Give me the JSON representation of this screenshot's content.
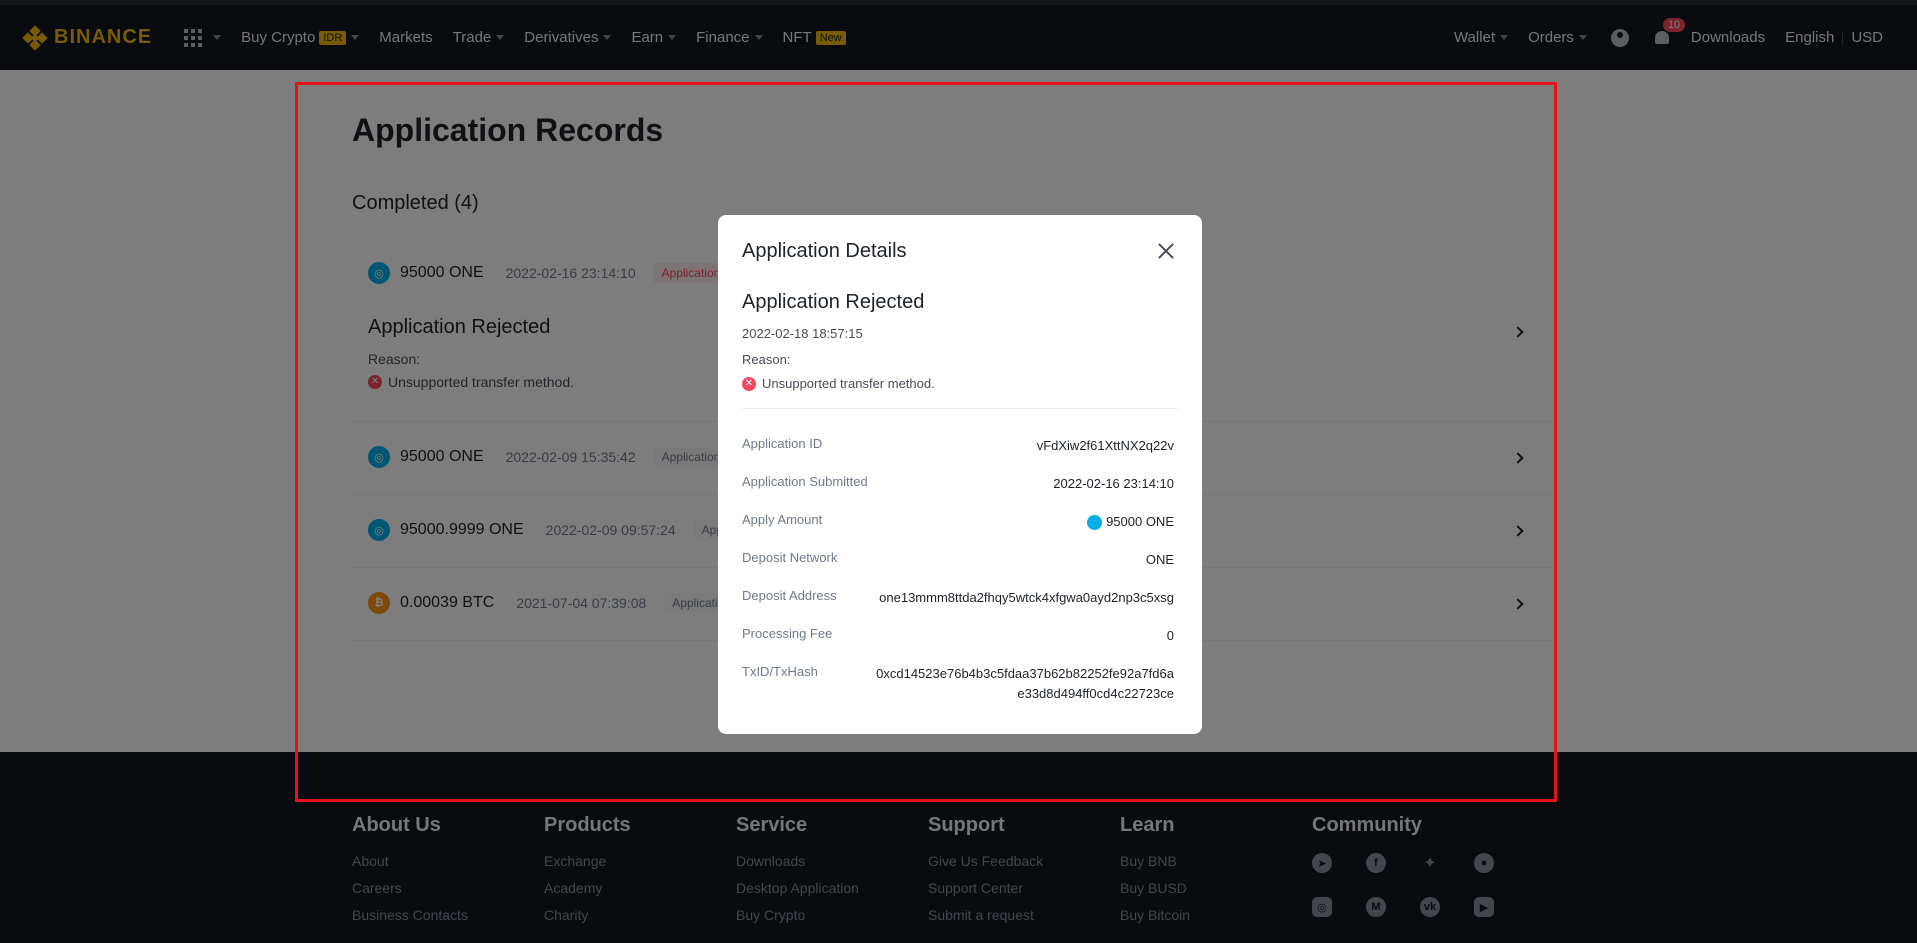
{
  "nav": {
    "brand": "BINANCE",
    "items": [
      {
        "label": "Buy Crypto",
        "tag": "IDR",
        "caret": true
      },
      {
        "label": "Markets",
        "tag": "",
        "caret": false
      },
      {
        "label": "Trade",
        "tag": "",
        "caret": true
      },
      {
        "label": "Derivatives",
        "tag": "",
        "caret": true
      },
      {
        "label": "Earn",
        "tag": "",
        "caret": true
      },
      {
        "label": "Finance",
        "tag": "",
        "caret": true
      },
      {
        "label": "NFT",
        "tag": "New",
        "caret": false
      }
    ],
    "wallet": "Wallet",
    "orders": "Orders",
    "notifications": "10",
    "downloads": "Downloads",
    "language": "English",
    "currency": "USD"
  },
  "page": {
    "title": "Application Records",
    "section": "Completed (4)"
  },
  "records": [
    {
      "amount": "95000 ONE",
      "time": "2022-02-16 23:14:10",
      "status": "Application Re",
      "coin": "ONE",
      "rejected_title": "Application Rejected",
      "reason_label": "Reason:",
      "reason": "Unsupported transfer method."
    },
    {
      "amount": "95000 ONE",
      "time": "2022-02-09 15:35:42",
      "status": "Application Re",
      "coin": "ONE"
    },
    {
      "amount": "95000.9999 ONE",
      "time": "2022-02-09 09:57:24",
      "status": "Appli",
      "coin": "ONE"
    },
    {
      "amount": "0.00039 BTC",
      "time": "2021-07-04 07:39:08",
      "status": "Application",
      "coin": "BTC"
    }
  ],
  "modal": {
    "title": "Application Details",
    "status": "Application Rejected",
    "date": "2022-02-18 18:57:15",
    "reason_label": "Reason:",
    "reason": "Unsupported transfer method.",
    "rows": [
      {
        "key": "Application ID",
        "value": "vFdXiw2f61XttNX2q22v"
      },
      {
        "key": "Application Submitted",
        "value": "2022-02-16 23:14:10"
      },
      {
        "key": "Apply Amount",
        "value": "95000 ONE"
      },
      {
        "key": "Deposit Network",
        "value": "ONE"
      },
      {
        "key": "Deposit Address",
        "value": "one13mmm8ttda2fhqy5wtck4xfgwa0ayd2np3c5xsg"
      },
      {
        "key": "Processing Fee",
        "value": "0"
      },
      {
        "key": "TxID/TxHash",
        "value": "0xcd14523e76b4b3c5fdaa37b62b82252fe92a7fd6ae33d8d494ff0cd4c22723ce"
      }
    ]
  },
  "footer": {
    "columns": [
      {
        "title": "About Us",
        "links": [
          "About",
          "Careers",
          "Business Contacts"
        ]
      },
      {
        "title": "Products",
        "links": [
          "Exchange",
          "Academy",
          "Charity"
        ]
      },
      {
        "title": "Service",
        "links": [
          "Downloads",
          "Desktop Application",
          "Buy Crypto"
        ]
      },
      {
        "title": "Support",
        "links": [
          "Give Us Feedback",
          "Support Center",
          "Submit a request"
        ]
      },
      {
        "title": "Learn",
        "links": [
          "Buy BNB",
          "Buy BUSD",
          "Buy Bitcoin"
        ]
      }
    ],
    "community_title": "Community",
    "social": [
      "telegram-icon",
      "facebook-icon",
      "twitter-icon",
      "reddit-icon",
      "instagram-icon",
      "coinmarketcap-icon",
      "vk-icon",
      "youtube-icon"
    ]
  },
  "colors": {
    "brand": "#f0b90b",
    "danger": "#f6465d",
    "dark": "#12161c"
  }
}
